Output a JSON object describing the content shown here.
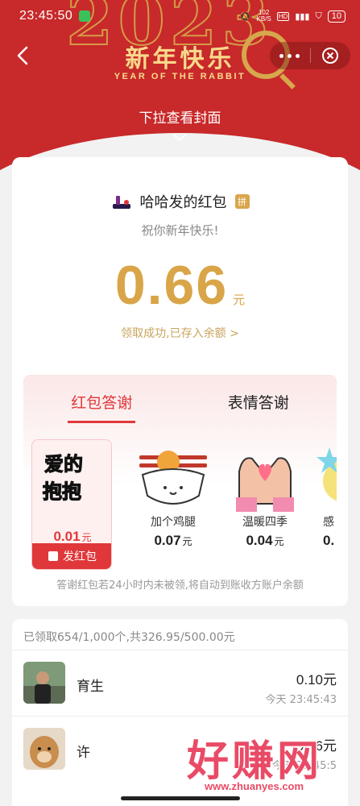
{
  "status_bar": {
    "time": "23:45:50",
    "network_speed": "102\nKB/S",
    "battery": "10"
  },
  "banner": {
    "year_text": "2023",
    "title": "新年快乐",
    "subtitle": "YEAR OF THE RABBIT",
    "pull_hint": "下拉查看封面"
  },
  "packet": {
    "sender_name": "哈哈发的红包",
    "badge": "拼",
    "greeting": "祝你新年快乐!",
    "amount": "0.66",
    "unit": "元",
    "received_text": "领取成功,已存入余额 >"
  },
  "thanks": {
    "tabs": [
      {
        "label": "红包答谢",
        "active": true
      },
      {
        "label": "表情答谢",
        "active": false
      }
    ],
    "stickers": [
      {
        "name": "爱的抱抱",
        "price": "0.01",
        "unit": "元",
        "selected": true,
        "button": "发红包"
      },
      {
        "name": "加个鸡腿",
        "price": "0.07",
        "unit": "元"
      },
      {
        "name": "温暖四季",
        "price": "0.04",
        "unit": "元"
      },
      {
        "name": "感",
        "price": "0.",
        "unit": ""
      }
    ],
    "note": "答谢红包若24小时内未被领,将自动到账收方账户余额"
  },
  "records": {
    "summary": "已领取654/1,000个,共326.95/500.00元",
    "items": [
      {
        "name": "育生",
        "amount": "0.10元",
        "time": "今天 23:45:43"
      },
      {
        "name": "许",
        "amount": "0.66元",
        "time": "今天 23:45:5"
      }
    ]
  },
  "watermark": {
    "text": "好赚网",
    "url": "www.zhuanyes.com"
  },
  "colors": {
    "header_red": "#c8292a",
    "gold": "#d9a548",
    "accent_red": "#e0383a"
  }
}
